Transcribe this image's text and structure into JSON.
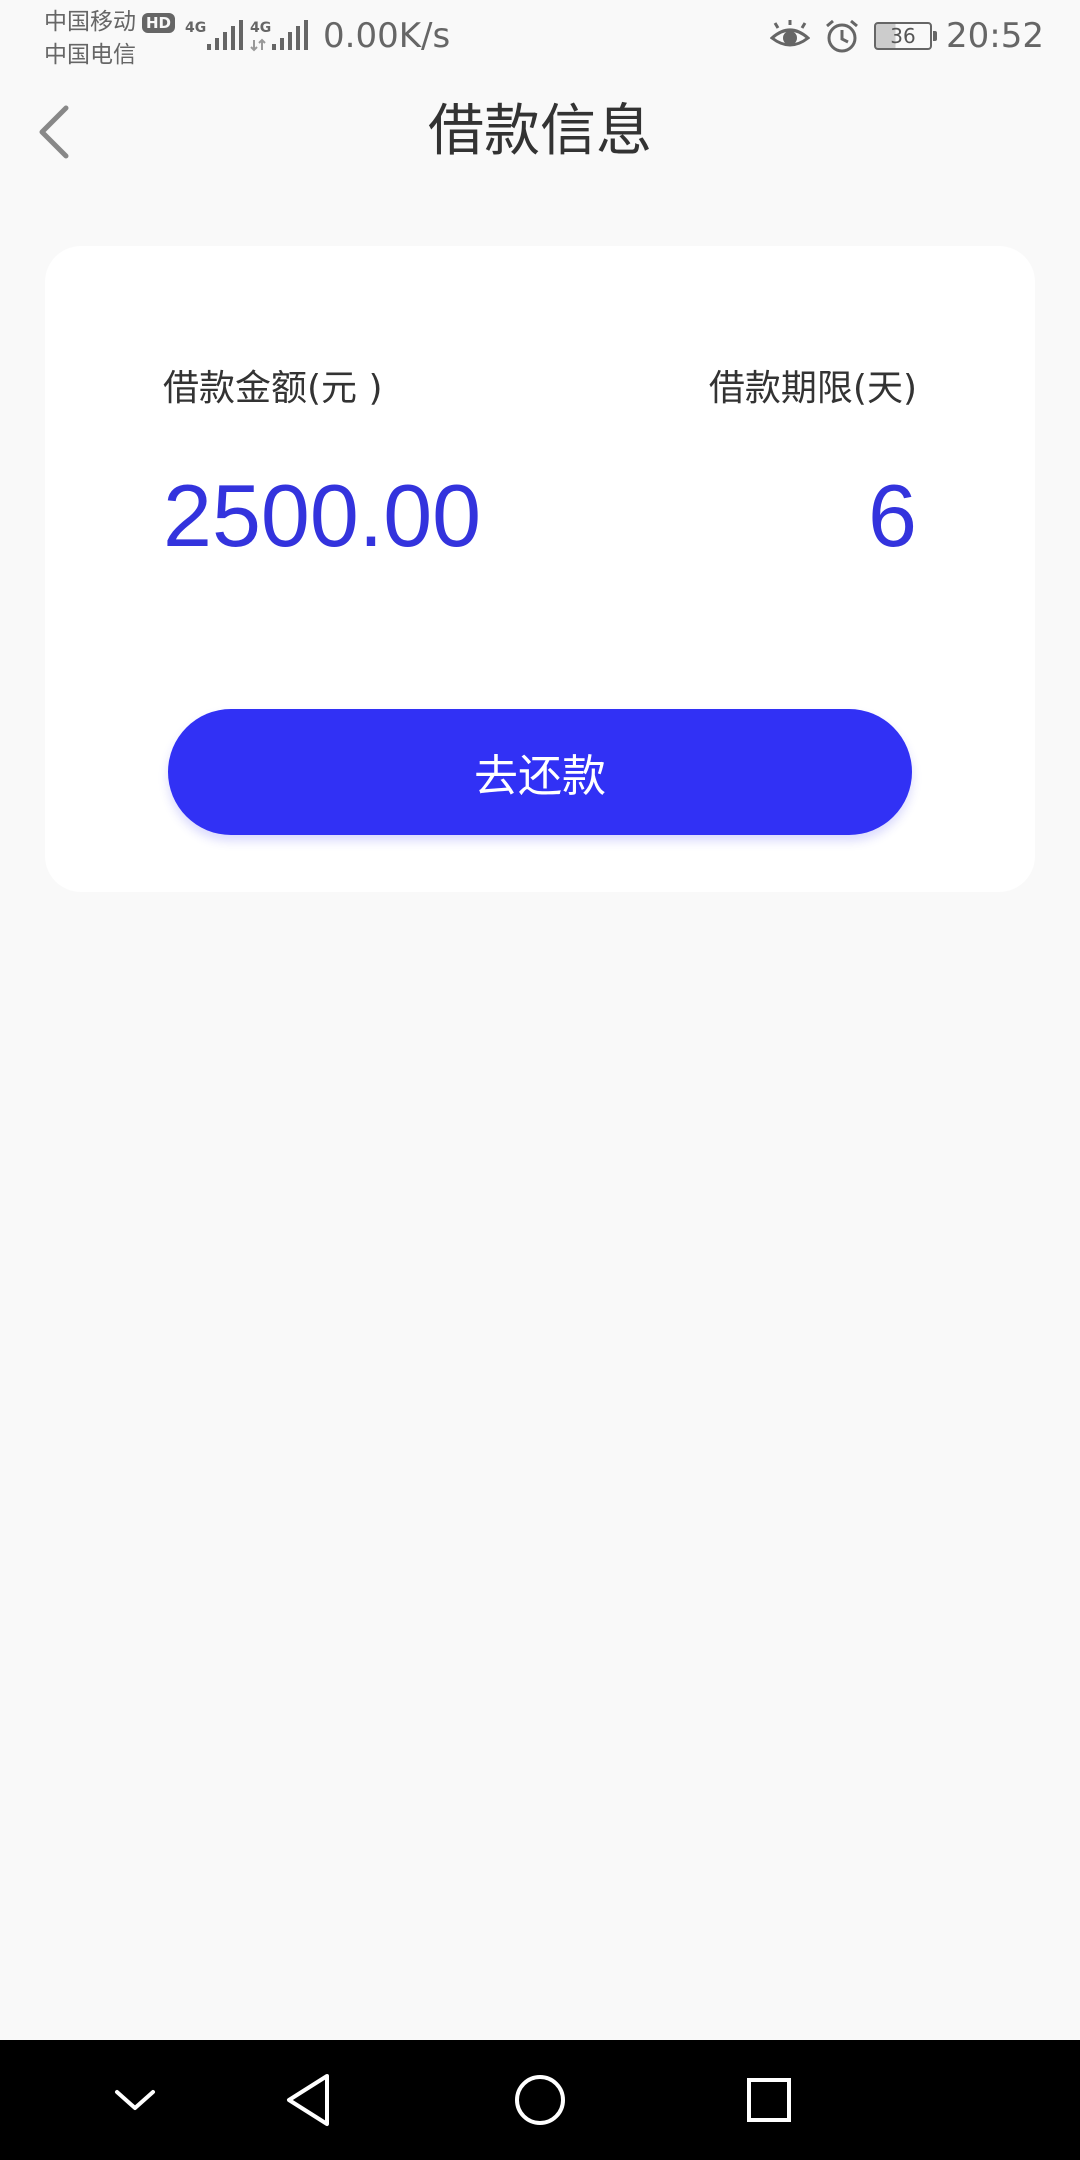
{
  "status_bar": {
    "carrier_1": "中国移动",
    "carrier_1_badge": "HD",
    "carrier_2": "中国电信",
    "network_1": "4G",
    "network_2": "4G",
    "net_speed": "0.00K/s",
    "battery_level": "36",
    "time": "20:52",
    "icons": [
      "eye-icon",
      "alarm-icon",
      "battery-icon"
    ]
  },
  "title_bar": {
    "title": "借款信息",
    "back_icon": "chevron-left-icon"
  },
  "loan_card": {
    "amount_label": "借款金额(元 )",
    "amount_value": "2500.00",
    "term_label": "借款期限(天)",
    "term_value": "6",
    "repay_button_label": "去还款"
  },
  "nav_bar": {
    "items": [
      "collapse-icon",
      "back-icon",
      "home-icon",
      "recents-icon"
    ]
  },
  "colors": {
    "accent": "#3131f5",
    "value_text": "#3333dd",
    "background": "#f9f9f9",
    "card": "#ffffff",
    "nav_bar": "#000000"
  }
}
